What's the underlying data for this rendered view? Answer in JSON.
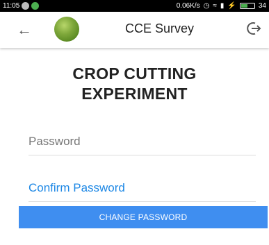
{
  "status_bar": {
    "time": "11:05",
    "network_speed": "0.06K/s",
    "battery": "34"
  },
  "toolbar": {
    "title": "CCE Survey"
  },
  "heading": {
    "line1": "CROP CUTTING",
    "line2": "EXPERIMENT"
  },
  "form": {
    "password_placeholder": "Password",
    "confirm_password_label": "Confirm Password",
    "change_password_label": "CHANGE PASSWORD"
  }
}
